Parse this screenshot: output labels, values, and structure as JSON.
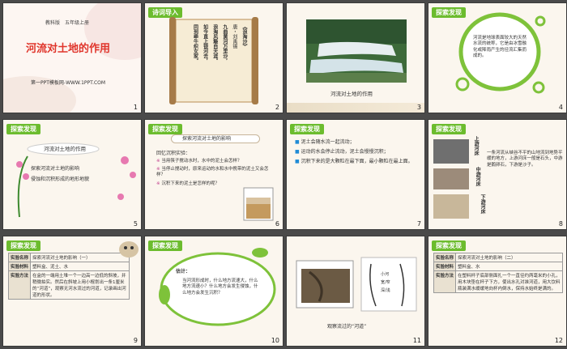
{
  "slides": [
    {
      "num": "1",
      "kicker": "教科版　五年级上册",
      "title": "河流对土地的作用",
      "footer": "第一PPT模板网-WWW.1PPT.COM"
    },
    {
      "num": "2",
      "tag": "诗词导入",
      "poem_title": "《浪淘沙》",
      "author": "唐・刘禹锡",
      "lines": [
        "九曲黄河万里沙，",
        "浪淘风簸自天涯。",
        "如今直上银河去，",
        "同到牵牛织女家。"
      ]
    },
    {
      "num": "3",
      "caption": "河流对土地的作用"
    },
    {
      "num": "4",
      "tag": "探索发现",
      "text": "河流是地球表面较大的天然水流的统称，它是由冰雪融化或降雨产生的径流汇集而成的。"
    },
    {
      "num": "5",
      "tag": "探索发现",
      "title": "河流对土地的作用",
      "items": [
        "探索河流对土地的影响",
        "侵蚀和沉积形成的地形地貌"
      ]
    },
    {
      "num": "6",
      "tag": "探索发现",
      "header": "探索河流对土地的影响",
      "intro": "回忆沉积实验：",
      "questions": [
        "当用筷子搅动水时，水中的泥土会怎样？",
        "当停止搅动时，原来运动的水和水中携带的泥土又会怎样？",
        "沉积下来的泥土是怎样的呢？"
      ]
    },
    {
      "num": "7",
      "tag": "探索发现",
      "items": [
        "泥土会随水流一起流动；",
        "运动的水会停止流动，泥土会慢慢沉积；",
        "沉积下来的是大颗粒在最下面，最小颗粒在最上面。"
      ]
    },
    {
      "num": "8",
      "tag": "探索发现",
      "labels": [
        "上游河床",
        "中游河床",
        "下游河床"
      ],
      "text": "一条河流从峡谷不平的山地流到地势平缓的地方，上游河床一般是石头，中游是鹅卵石，下游是沙子。"
    },
    {
      "num": "9",
      "tag": "探索发现",
      "rows": [
        [
          "实验名称",
          "探索河流对土地的影响（一）"
        ],
        [
          "实验材料",
          "塑料盒、泥土、水"
        ],
        [
          "实验方法",
          "在盒的一端用土堆一个一边高一边低的斜坡，并稍微拍实。然后在斜坡上用小棍划出一条1厘米的“河道”，观察无河水流过的河道，记录画出河道的形状。"
        ]
      ]
    },
    {
      "num": "10",
      "tag": "探索发现",
      "label": "估计：",
      "text": "当河流形成时，什么地方流速大，什么地方流速小？什么地方会发生侵蚀，什么地方会发生沉积？"
    },
    {
      "num": "11",
      "tag": "探索发现",
      "caption": "观察流过的“河道”",
      "sketch_labels": [
        "小河",
        "宽/窄",
        "深/浅"
      ]
    },
    {
      "num": "12",
      "tag": "探索发现",
      "rows": [
        [
          "实验名称",
          "探索河流对土地的影响（二）"
        ],
        [
          "实验材料",
          "塑料盒、水"
        ],
        [
          "实验方法",
          "在塑料杯子底部侧面扎一个一直径约两毫米的小孔，用木块垫在杯子下方，使出水孔对准河道，用大饮料瓶装满水缓缓地向杯内倒水，保持水始终是满的。"
        ]
      ]
    }
  ],
  "colors": {
    "accent_green": "#6cbc2e",
    "title_red": "#e0352b",
    "bg_cream": "#fbf6ee"
  }
}
